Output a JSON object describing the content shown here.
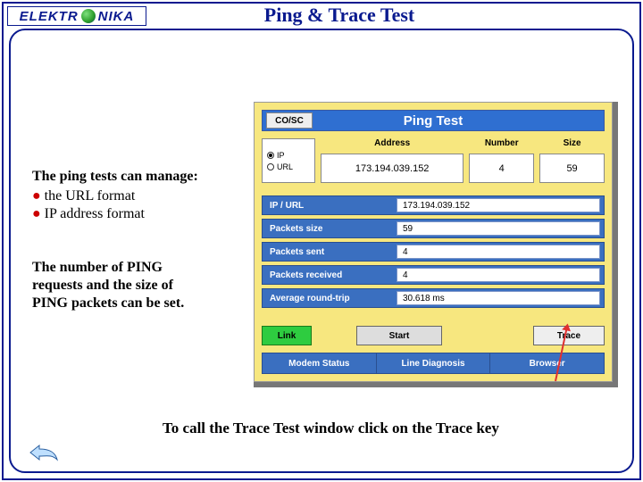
{
  "brand": {
    "left": "ELEKTR",
    "right": "NIKA"
  },
  "title": "Ping & Trace Test",
  "left_panel": {
    "heading": "The ping tests can manage:",
    "bullets": [
      "the URL format",
      "IP address format"
    ],
    "para2_l1": "The number of PING",
    "para2_l2": "requests and the size of",
    "para2_l3": "PING packets can be set."
  },
  "footnote": "To call the Trace Test window click on the Trace key",
  "device": {
    "cosc": "CO/SC",
    "title": "Ping Test",
    "radio_ip": "IP",
    "radio_url": "URL",
    "cols": {
      "address_label": "Address",
      "number_label": "Number",
      "size_label": "Size",
      "address_value": "173.194.039.152",
      "number_value": "4",
      "size_value": "59"
    },
    "results": [
      {
        "label": "IP / URL",
        "value": "173.194.039.152"
      },
      {
        "label": "Packets size",
        "value": "59"
      },
      {
        "label": "Packets sent",
        "value": "4"
      },
      {
        "label": "Packets received",
        "value": "4"
      },
      {
        "label": "Average round-trip",
        "value": "30.618 ms"
      }
    ],
    "buttons": {
      "link": "Link",
      "start": "Start",
      "trace": "Trace"
    },
    "bottom_bar": [
      "Modem Status",
      "Line Diagnosis",
      "Browser"
    ]
  }
}
